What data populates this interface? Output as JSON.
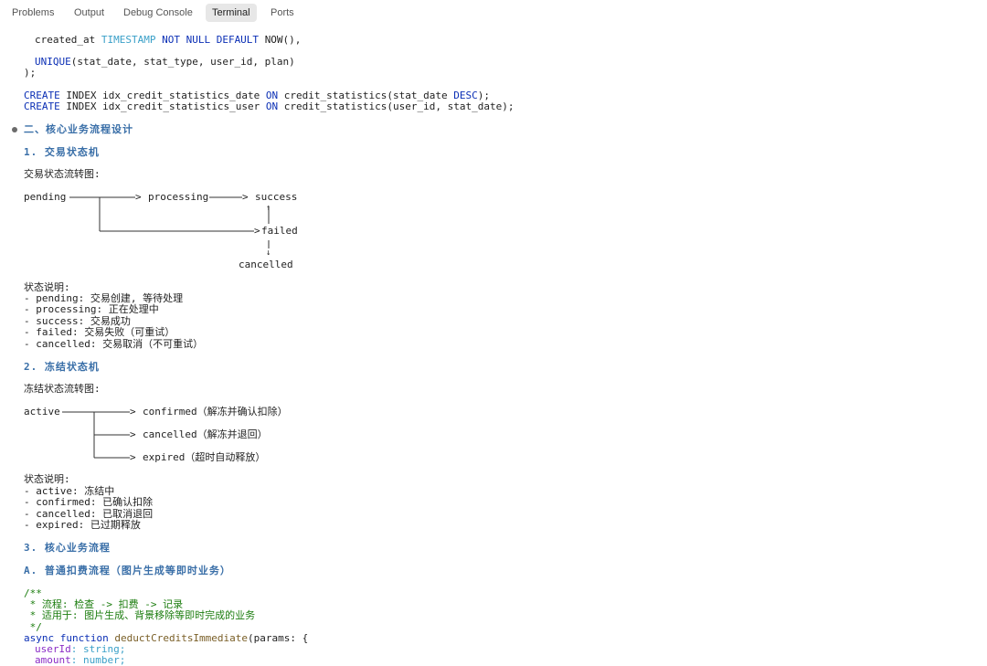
{
  "tabs": [
    "Problems",
    "Output",
    "Debug Console",
    "Terminal",
    "Ports"
  ],
  "active_tab": "Terminal",
  "sql": {
    "created_at_col": "created_at",
    "created_at_type": "TIMESTAMP",
    "created_at_kw": "NOT NULL DEFAULT",
    "created_at_rest": "NOW(),",
    "unique_kw": "UNIQUE",
    "unique_rest": "(stat_date, stat_type, user_id, plan)",
    "close": ");",
    "idx1_kw1": "CREATE",
    "idx1_mid": " INDEX idx_credit_statistics_date ",
    "idx1_on": "ON",
    "idx1_rest": " credit_statistics(stat_date ",
    "idx1_desc": "DESC",
    "idx1_end": ");",
    "idx2_kw1": "CREATE",
    "idx2_mid": " INDEX idx_credit_statistics_user ",
    "idx2_on": "ON",
    "idx2_rest": " credit_statistics(user_id, stat_date);"
  },
  "section2_title": "二、核心业务流程设计",
  "sub1_title": "1. 交易状态机",
  "flow1_caption": "交易状态流转图:",
  "flow1": {
    "pending": "pending",
    "processing": "processing",
    "success": "success",
    "failed": "failed",
    "cancelled": "cancelled"
  },
  "status1_title": "状态说明:",
  "status1_items": [
    "- pending: 交易创建, 等待处理",
    "- processing: 正在处理中",
    "- success: 交易成功",
    "- failed: 交易失败（可重试）",
    "- cancelled: 交易取消（不可重试）"
  ],
  "sub2_title": "2. 冻结状态机",
  "flow2_caption": "冻结状态流转图:",
  "flow2": {
    "active": "active",
    "confirmed": "confirmed（解冻并确认扣除）",
    "cancelled": "cancelled（解冻并退回）",
    "expired": "expired（超时自动释放）"
  },
  "status2_title": "状态说明:",
  "status2_items": [
    "- active: 冻结中",
    "- confirmed: 已确认扣除",
    "- cancelled: 已取消退回",
    "- expired: 已过期释放"
  ],
  "sub3_title": "3. 核心业务流程",
  "subA_title": "A. 普通扣费流程（图片生成等即时业务）",
  "code": {
    "c1": "/**",
    "c2": " * 流程: 检查 -> 扣费 -> 记录",
    "c3": " * 适用于: 图片生成、背景移除等即时完成的业务",
    "c4": " */",
    "async_kw": "async function",
    "fn_name": "deductCreditsImmediate",
    "fn_rest": "(params: {",
    "p1_name": "userId",
    "p1_type": ": string;",
    "p2_name": "amount",
    "p2_type": ": number;"
  }
}
